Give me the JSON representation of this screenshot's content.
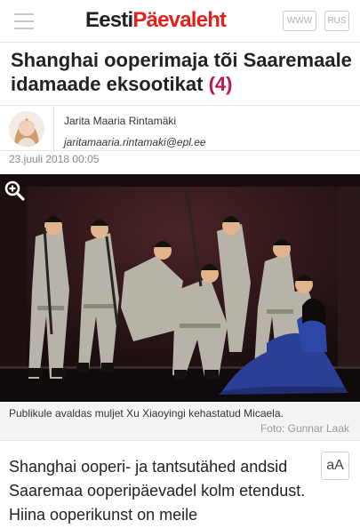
{
  "header": {
    "logo_part1": "Eesti",
    "logo_part2": "Päevaleht",
    "lang_www": "WWW",
    "lang_rus": "RUS"
  },
  "article": {
    "title": "Shanghai ooperimaja tõi Saaremaale idamaade eksootikat",
    "comment_count": "(4)",
    "author_name": "Jarita Maaria Rintamäki",
    "author_email": "jaritamaaria.rintamaki@epl.ee",
    "date": "23.juuli 2018 00:05",
    "photo_caption": "Publikule avaldas muljet Xu Xiaoyingi kehastatud Micaela.",
    "photo_credit": "Foto: Gunnar Laak",
    "lead": "Shanghai ooperi- ja tantsutähed andsid Saaremaa ooperipäevadel kolm etendust. Hiina ooperikunst on meile",
    "font_size_button": "aA"
  },
  "colors": {
    "brand_red": "#e4201b",
    "count_color": "#c0164b"
  },
  "icons": {
    "menu": "hamburger-icon",
    "zoom": "zoom-in-icon"
  }
}
